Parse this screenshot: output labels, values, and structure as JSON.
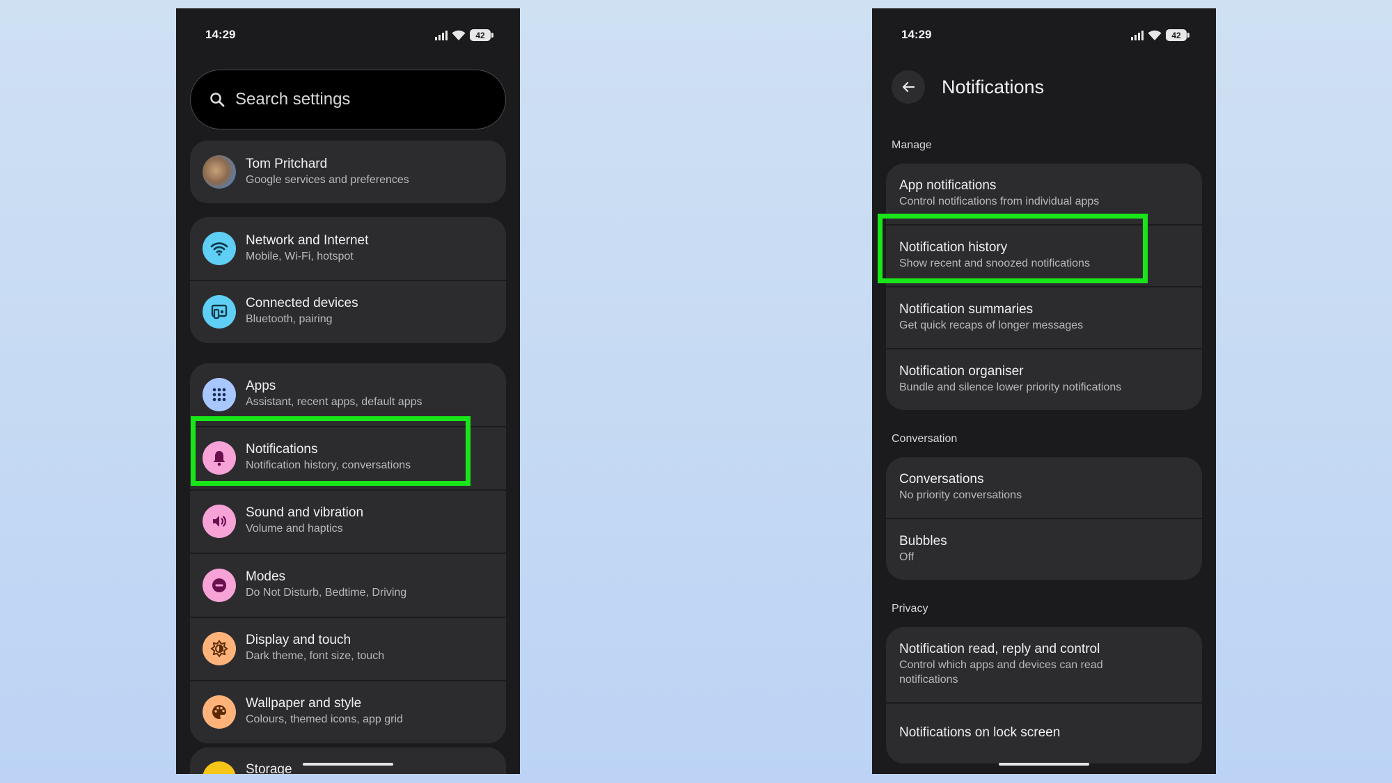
{
  "left": {
    "status": {
      "time": "14:29",
      "battery": "42"
    },
    "search": {
      "placeholder": "Search settings"
    },
    "account": {
      "name": "Tom Pritchard",
      "sub": "Google services and preferences"
    },
    "items": [
      {
        "title": "Network and Internet",
        "sub": "Mobile, Wi-Fi, hotspot",
        "icon": "wifi-icon",
        "color": "#5fcff5"
      },
      {
        "title": "Connected devices",
        "sub": "Bluetooth, pairing",
        "icon": "devices-icon",
        "color": "#5fcff5"
      },
      {
        "title": "Apps",
        "sub": "Assistant, recent apps, default apps",
        "icon": "apps-grid-icon",
        "color": "#a9c7ff"
      },
      {
        "title": "Notifications",
        "sub": "Notification history, conversations",
        "icon": "bell-icon",
        "color": "#f7a3d8"
      },
      {
        "title": "Sound and vibration",
        "sub": "Volume and haptics",
        "icon": "speaker-icon",
        "color": "#f7a3d8"
      },
      {
        "title": "Modes",
        "sub": "Do Not Disturb, Bedtime, Driving",
        "icon": "minus-circle-icon",
        "color": "#f7a3d8"
      },
      {
        "title": "Display and touch",
        "sub": "Dark theme, font size, touch",
        "icon": "brightness-icon",
        "color": "#ffb37a"
      },
      {
        "title": "Wallpaper and style",
        "sub": "Colours, themed icons, app grid",
        "icon": "palette-icon",
        "color": "#ffb37a"
      },
      {
        "title": "Storage",
        "sub": "",
        "icon": "storage-icon",
        "color": "#f5c518"
      }
    ]
  },
  "right": {
    "status": {
      "time": "14:29",
      "battery": "42"
    },
    "title": "Notifications",
    "sections": [
      {
        "label": "Manage",
        "items": [
          {
            "title": "App notifications",
            "sub": "Control notifications from individual apps"
          },
          {
            "title": "Notification history",
            "sub": "Show recent and snoozed notifications"
          },
          {
            "title": "Notification summaries",
            "sub": "Get quick recaps of longer messages"
          },
          {
            "title": "Notification organiser",
            "sub": "Bundle and silence lower priority notifications"
          }
        ]
      },
      {
        "label": "Conversation",
        "items": [
          {
            "title": "Conversations",
            "sub": "No priority conversations"
          },
          {
            "title": "Bubbles",
            "sub": "Off"
          }
        ]
      },
      {
        "label": "Privacy",
        "items": [
          {
            "title": "Notification read, reply and control",
            "sub": "Control which apps and devices can read notifications"
          },
          {
            "title": "Notifications on lock screen",
            "sub": ""
          }
        ]
      }
    ]
  },
  "colors": {
    "highlight": "#19e619",
    "card": "#2c2c2f",
    "background": "#1b1b1d"
  }
}
